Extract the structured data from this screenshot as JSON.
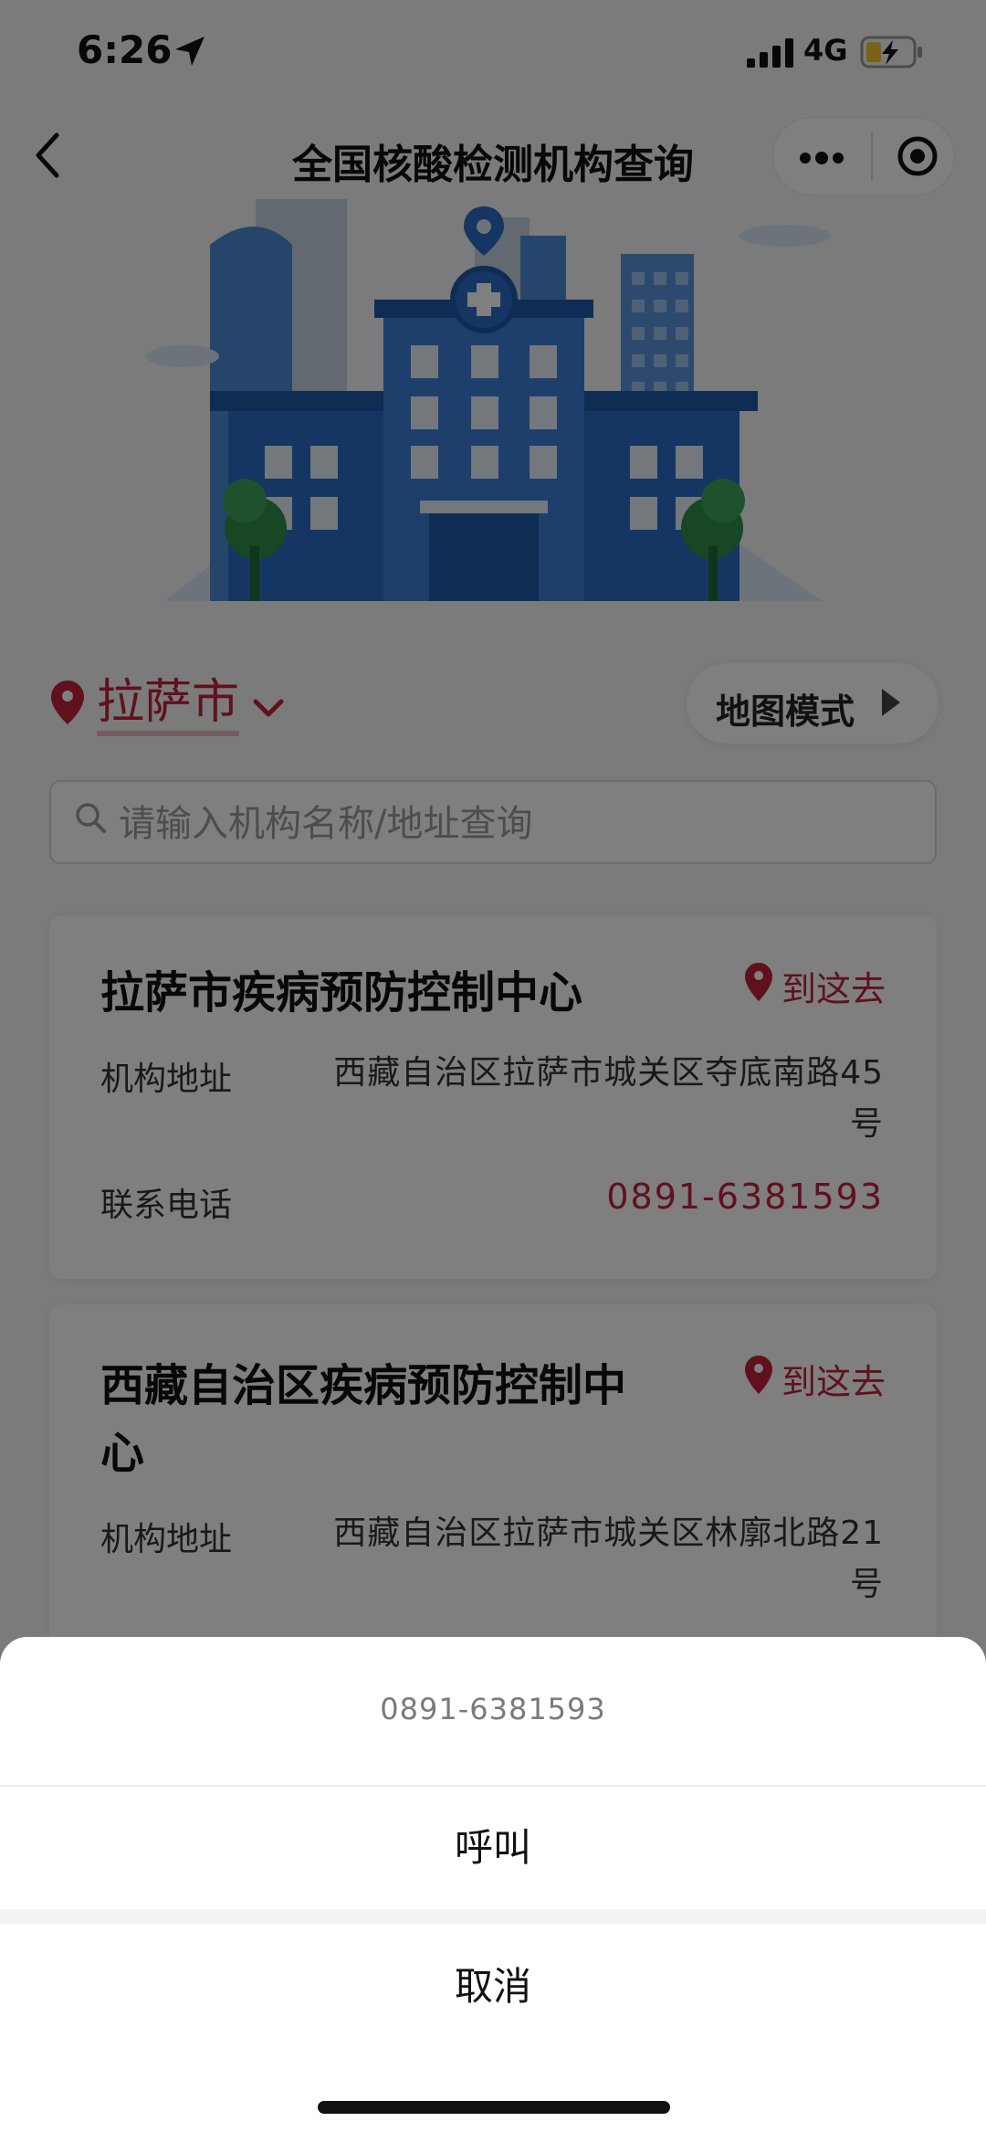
{
  "status_bar": {
    "time": "6:26",
    "network": "4G"
  },
  "nav": {
    "title": "全国核酸检测机构查询"
  },
  "city": {
    "name": "拉萨市",
    "map_mode_label": "地图模式"
  },
  "search": {
    "placeholder": "请输入机构名称/地址查询"
  },
  "cards": [
    {
      "title": "拉萨市疾病预防控制中心",
      "navigate_label": "到这去",
      "address_label": "机构地址",
      "address_line1": "西藏自治区拉萨市城关区夺底南路45",
      "address_line2": "号",
      "phone_label": "联系电话",
      "phone": "0891-6381593"
    },
    {
      "title_line1": "西藏自治区疾病预防控制中",
      "title_line2": "心",
      "navigate_label": "到这去",
      "address_label": "机构地址",
      "address_line1": "西藏自治区拉萨市城关区林廓北路21",
      "address_line2": "号"
    }
  ],
  "action_sheet": {
    "title": "0891-6381593",
    "call_label": "呼叫",
    "cancel_label": "取消"
  },
  "colors": {
    "accent": "#c0223a",
    "overlay": "rgba(0,0,0,0.5)"
  }
}
